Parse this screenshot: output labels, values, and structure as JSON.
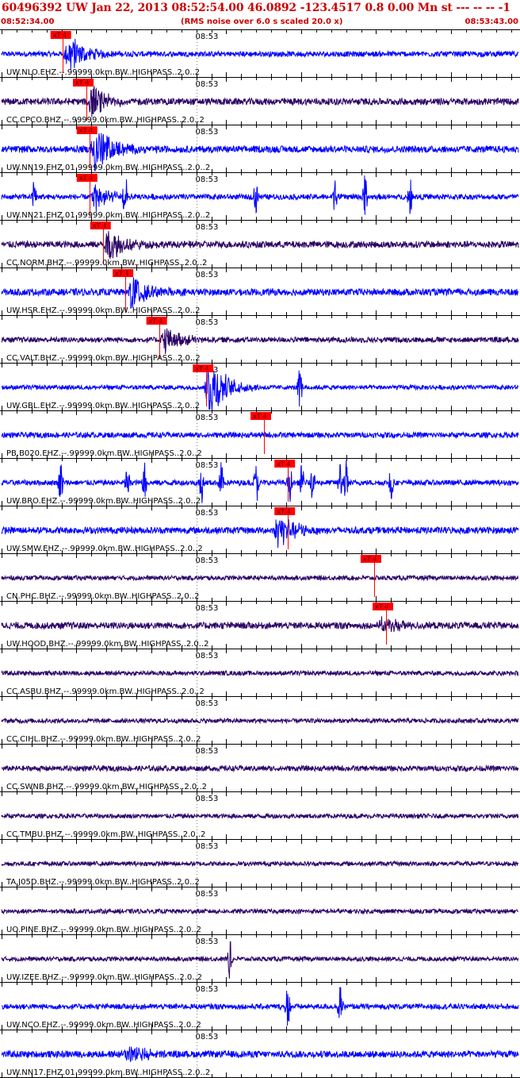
{
  "header": {
    "title": "60496392 UW Jan 22, 2013 08:52:54.00   46.0892 -123.4517  0.8 0.00 Mn st --- -- --   -1",
    "start_time": "08:52:34.00",
    "note": "(RMS noise over 6.0 s scaled 20.0 x)",
    "end_time": "08:53:43.00"
  },
  "colors": {
    "header_text": "#cc0000",
    "trace_blue": "#0000ff",
    "trace_dark": "#2a0066",
    "pick": "#ff0000",
    "axis": "#000000"
  },
  "chart_data": {
    "type": "line",
    "time_range": [
      "08:52:34.00",
      "08:53:43.00"
    ],
    "minute_label": "08:53",
    "pick_label": "xT 4",
    "traces": [
      {
        "label": "UW.NLO.EHZ.--.99999.0km.BW..HIGHPASS..2.0..2",
        "color": "blue",
        "pick_time_s": 8.2,
        "signal_time_s": 9.0,
        "amp": 0.55,
        "noise": 0.12,
        "spikes": [],
        "pick_label_time_s": 7.8
      },
      {
        "label": "CC.CPCO.BHZ.--.99999.0km.BW..HIGHPASS..2.0..2",
        "color": "dark",
        "pick_time_s": 11.3,
        "signal_time_s": 12.0,
        "amp": 0.45,
        "noise": 0.15,
        "spikes": [],
        "pick_label_time_s": 10.8
      },
      {
        "label": "UW.NN19.EHZ.01.99999.0km.BW..HIGHPASS..2.0..2",
        "color": "blue",
        "pick_time_s": 11.7,
        "signal_time_s": 12.5,
        "amp": 0.75,
        "noise": 0.15,
        "spikes": [],
        "pick_label_time_s": 11.3
      },
      {
        "label": "UW.NN21.EHZ.01.99999.0km.BW..HIGHPASS..2.0..2",
        "color": "blue",
        "pick_time_s": 11.7,
        "signal_time_s": 12.5,
        "amp": 0.4,
        "noise": 0.12,
        "spikes": [
          4.4,
          16.5,
          34.0,
          44.5,
          48.5,
          54.5
        ],
        "pick_label_time_s": 11.3
      },
      {
        "label": "CC.NORM.BHZ.--.99999.0km.BW..HIGHPASS..2.0..2",
        "color": "dark",
        "pick_time_s": 13.5,
        "signal_time_s": 14.3,
        "amp": 0.5,
        "noise": 0.15,
        "spikes": [],
        "pick_label_time_s": 13.1
      },
      {
        "label": "UW.HSR.EHZ.--.99999.0km.BW..HIGHPASS..2.0..2",
        "color": "blue",
        "pick_time_s": 16.5,
        "signal_time_s": 17.4,
        "amp": 0.6,
        "noise": 0.15,
        "spikes": [],
        "pick_label_time_s": 16.1
      },
      {
        "label": "CC.VALT.BHZ.--.99999.0km.BW..HIGHPASS..2.0..2",
        "color": "dark",
        "pick_time_s": 21.1,
        "signal_time_s": 21.8,
        "amp": 0.4,
        "noise": 0.12,
        "spikes": [],
        "pick_label_time_s": 20.6
      },
      {
        "label": "UW.GBL.EHZ.--.99999.0km.BW..HIGHPASS..2.0..2",
        "color": "blue",
        "pick_time_s": 27.3,
        "signal_time_s": 27.8,
        "amp": 0.9,
        "noise": 0.1,
        "spikes": [
          39.8
        ],
        "pick_label_time_s": 26.8
      },
      {
        "label": "PB.B020.EHZ.--.99999.0km.BW..HIGHPASS..2.0..2",
        "color": "blue",
        "pick_time_s": 35.0,
        "signal_time_s": null,
        "amp": 0,
        "noise": 0.12,
        "spikes": [],
        "pick_label_time_s": 34.5
      },
      {
        "label": "UW.BRO.EHZ.--.99999.0km.BW..HIGHPASS..2.0..2",
        "color": "blue",
        "pick_time_s": 38.2,
        "signal_time_s": null,
        "amp": 0,
        "noise": 0.12,
        "spikes": [
          7.9,
          16.8,
          19.1,
          26.7,
          29.3,
          34.0,
          38.5,
          40.1,
          41.5,
          45.2,
          46.0,
          52.0
        ],
        "pick_label_time_s": 37.7
      },
      {
        "label": "UW.SMW.EHZ.--.99999.0km.BW..HIGHPASS..2.0..2",
        "color": "blue",
        "pick_time_s": 38.2,
        "signal_time_s": 37.0,
        "amp": 0.5,
        "noise": 0.15,
        "spikes": [],
        "pick_label_time_s": 37.7
      },
      {
        "label": "CN.PHC.BHZ.--.99999.0km.BW..HIGHPASS..2.0..2",
        "color": "dark",
        "pick_time_s": 49.7,
        "signal_time_s": null,
        "amp": 0,
        "noise": 0.1,
        "spikes": [],
        "pick_label_time_s": 49.2
      },
      {
        "label": "UW.HOOD.BHZ.--.99999.0km.BW..HIGHPASS..2.0..2",
        "color": "dark",
        "pick_time_s": 51.3,
        "signal_time_s": 51.0,
        "amp": 0.25,
        "noise": 0.15,
        "spikes": [],
        "pick_label_time_s": 50.8
      },
      {
        "label": "CC.ASBU.BHZ.--.99999.0km.BW..HIGHPASS..2.0..2",
        "color": "dark",
        "pick_time_s": null,
        "signal_time_s": null,
        "amp": 0,
        "noise": 0.1,
        "spikes": [],
        "pick_label_time_s": null
      },
      {
        "label": "CC.CIHL.BHZ.--.99999.0km.BW..HIGHPASS..2.0..2",
        "color": "dark",
        "pick_time_s": null,
        "signal_time_s": null,
        "amp": 0,
        "noise": 0.1,
        "spikes": [],
        "pick_label_time_s": null
      },
      {
        "label": "CC.SWNB.BHZ.--.99999.0km.BW..HIGHPASS..2.0..2",
        "color": "dark",
        "pick_time_s": null,
        "signal_time_s": null,
        "amp": 0,
        "noise": 0.12,
        "spikes": [],
        "pick_label_time_s": null
      },
      {
        "label": "CC.TMBU.BHZ.--.99999.0km.BW..HIGHPASS..2.0..2",
        "color": "dark",
        "pick_time_s": null,
        "signal_time_s": null,
        "amp": 0,
        "noise": 0.1,
        "spikes": [],
        "pick_label_time_s": null
      },
      {
        "label": "TA.J05D.BHZ.--.99999.0km.BW..HIGHPASS..2.0..2",
        "color": "dark",
        "pick_time_s": null,
        "signal_time_s": null,
        "amp": 0,
        "noise": 0.1,
        "spikes": [],
        "pick_label_time_s": null
      },
      {
        "label": "UO.PINE.BHZ.--.99999.0km.BW..HIGHPASS..2.0..2",
        "color": "dark",
        "pick_time_s": null,
        "signal_time_s": null,
        "amp": 0,
        "noise": 0.1,
        "spikes": [],
        "pick_label_time_s": null
      },
      {
        "label": "UW.IZEE.BHZ.--.99999.0km.BW..HIGHPASS..2.0..2",
        "color": "dark",
        "pick_time_s": null,
        "signal_time_s": null,
        "amp": 0,
        "noise": 0.1,
        "spikes": [
          30.5
        ],
        "pick_label_time_s": null
      },
      {
        "label": "UW.NCO.EHZ.--.99999.0km.BW..HIGHPASS..2.0..2",
        "color": "blue",
        "pick_time_s": null,
        "signal_time_s": null,
        "amp": 0,
        "noise": 0.12,
        "spikes": [
          38.2,
          45.2
        ],
        "pick_label_time_s": null
      },
      {
        "label": "UW.NN17.EHZ.01.99999.0km.BW..HIGHPASS..2.0..2",
        "color": "blue",
        "pick_time_s": null,
        "signal_time_s": 17.0,
        "amp": 0.3,
        "noise": 0.15,
        "spikes": [],
        "pick_label_time_s": null
      }
    ]
  }
}
